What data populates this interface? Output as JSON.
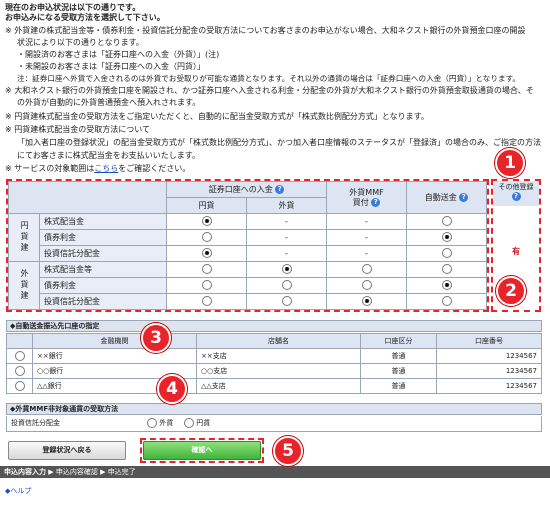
{
  "header": {
    "line1": "現在のお申込状況は以下の通りです。",
    "line2": "お申込みになる受取方法を選択して下さい。"
  },
  "notes": [
    "※ 外貨建の株式配当金等・債券利金・投資信託分配金の受取方法についてお客さまのお申込がない場合、大和ネクスト銀行の外貨預金口座の開設",
    "状況により以下の通りとなります。",
    "・開設済のお客さまは「証券口座への入金（外貨）」(注)",
    "・未開設のお客さまは「証券口座への入金（円貨）」",
    "注：証券口座へ外貨で入金されるのは外貨でお受取りが可能な通貨となります。それ以外の通貨の場合は「証券口座への入金（円貨）」となります。",
    "※ 大和ネクスト銀行の外貨預金口座を開設され、かつ証券口座へ入金される利金・分配金の外貨が大和ネクスト銀行の外貨預金取扱通貨の場合、そ",
    "の外貨が自動的に外貨普通預金へ預入れされます。",
    "※ 円貨建株式配当金の受取方法をご指定いただくと、自動的に配当金受取方式が「株式数比例配分方式」となります。",
    "※ 円貨建株式配当金の受取方法について",
    "「加入者口座の登録状況」の配当金受取方式が「株式数比例配分方式」、かつ加入者口座情報のステータスが「登録済」の場合のみ、ご指定の方法",
    "にてお客さまに株式配当金をお支払いいたします。"
  ],
  "service_note": {
    "prefix": "※ サービスの対象範囲は",
    "link": "こちら",
    "suffix": "をご確認ください。"
  },
  "table": {
    "col_group_securities": "証券口座への入金",
    "col_yen": "円貨",
    "col_foreign": "外貨",
    "col_mmf": "外貨MMF",
    "col_mmf2": "買付",
    "col_auto": "自動送金",
    "col_other": "その他登録",
    "group_yen": "円貨建",
    "group_foreign": "外貨建",
    "other_value": "有",
    "rows": [
      {
        "label": "株式配当金",
        "c1": "on",
        "c2": "-",
        "c3": "-",
        "c4": "off"
      },
      {
        "label": "債券利金",
        "c1": "off",
        "c2": "-",
        "c3": "-",
        "c4": "on"
      },
      {
        "label": "投資信託分配金",
        "c1": "on",
        "c2": "-",
        "c3": "-",
        "c4": "off"
      },
      {
        "label": "株式配当金等",
        "c1": "off",
        "c2": "on",
        "c3": "off",
        "c4": "off"
      },
      {
        "label": "債券利金",
        "c1": "off",
        "c2": "off",
        "c3": "off",
        "c4": "on"
      },
      {
        "label": "投資信託分配金",
        "c1": "off",
        "c2": "off",
        "c3": "on",
        "c4": "off"
      }
    ]
  },
  "bank_section": {
    "title": "◆自動送金振込先口座の指定",
    "headers": [
      "金融機関",
      "店舗名",
      "口座区分",
      "口座番号"
    ],
    "rows": [
      {
        "bank": "××銀行",
        "branch": "××支店",
        "type": "普通",
        "number": "1234567"
      },
      {
        "bank": "○○銀行",
        "branch": "○○支店",
        "type": "普通",
        "number": "1234567"
      },
      {
        "bank": "△△銀行",
        "branch": "△△支店",
        "type": "普通",
        "number": "1234567"
      }
    ]
  },
  "mmf_section": {
    "title": "◆外貨MMF非対象通貨の受取方法",
    "label": "投資信託分配金",
    "opt_foreign": "外貨",
    "opt_yen": "円貨"
  },
  "buttons": {
    "back": "登録状況へ戻る",
    "confirm": "確認へ"
  },
  "steps": {
    "s1": "申込内容入力",
    "s2": "申込内容確認",
    "s3": "申込完了"
  },
  "help": "◆ヘルプ",
  "badges": [
    "1",
    "2",
    "3",
    "4",
    "5"
  ],
  "colors": {
    "accent_red": "#e8232a",
    "header_blue": "#dde4f2",
    "confirm_green": "#4caf50",
    "step_bar": "#555555"
  }
}
